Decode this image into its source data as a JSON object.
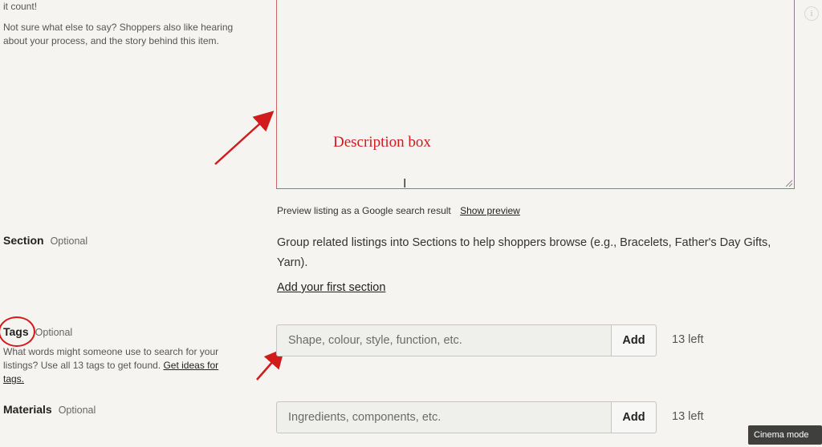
{
  "description": {
    "help_tail": "it count!",
    "help_extra": "Not sure what else to say? Shoppers also like hearing about your process, and the story behind this item.",
    "annotation": "Description box"
  },
  "preview": {
    "text": "Preview listing as a Google search result",
    "link": "Show preview"
  },
  "section": {
    "label": "Section",
    "optional": "Optional",
    "description": "Group related listings into Sections to help shoppers browse (e.g., Bracelets, Father's Day Gifts, Yarn).",
    "add_link": "Add your first section"
  },
  "tags": {
    "label": "Tags",
    "optional": "Optional",
    "help": "What words might someone use to search for your listings? Use all 13 tags to get found.",
    "help_link": "Get ideas for tags.",
    "placeholder": "Shape, colour, style, function, etc.",
    "add_label": "Add",
    "count": "13 left"
  },
  "materials": {
    "label": "Materials",
    "optional": "Optional",
    "placeholder": "Ingredients, components, etc.",
    "add_label": "Add",
    "count": "13 left"
  },
  "player": {
    "info_glyph": "i",
    "tooltip": "Cinema mode (t)"
  },
  "colors": {
    "annotation_red": "#d01c1c",
    "box_border": "#c9655f",
    "background": "#f5f4f0"
  }
}
